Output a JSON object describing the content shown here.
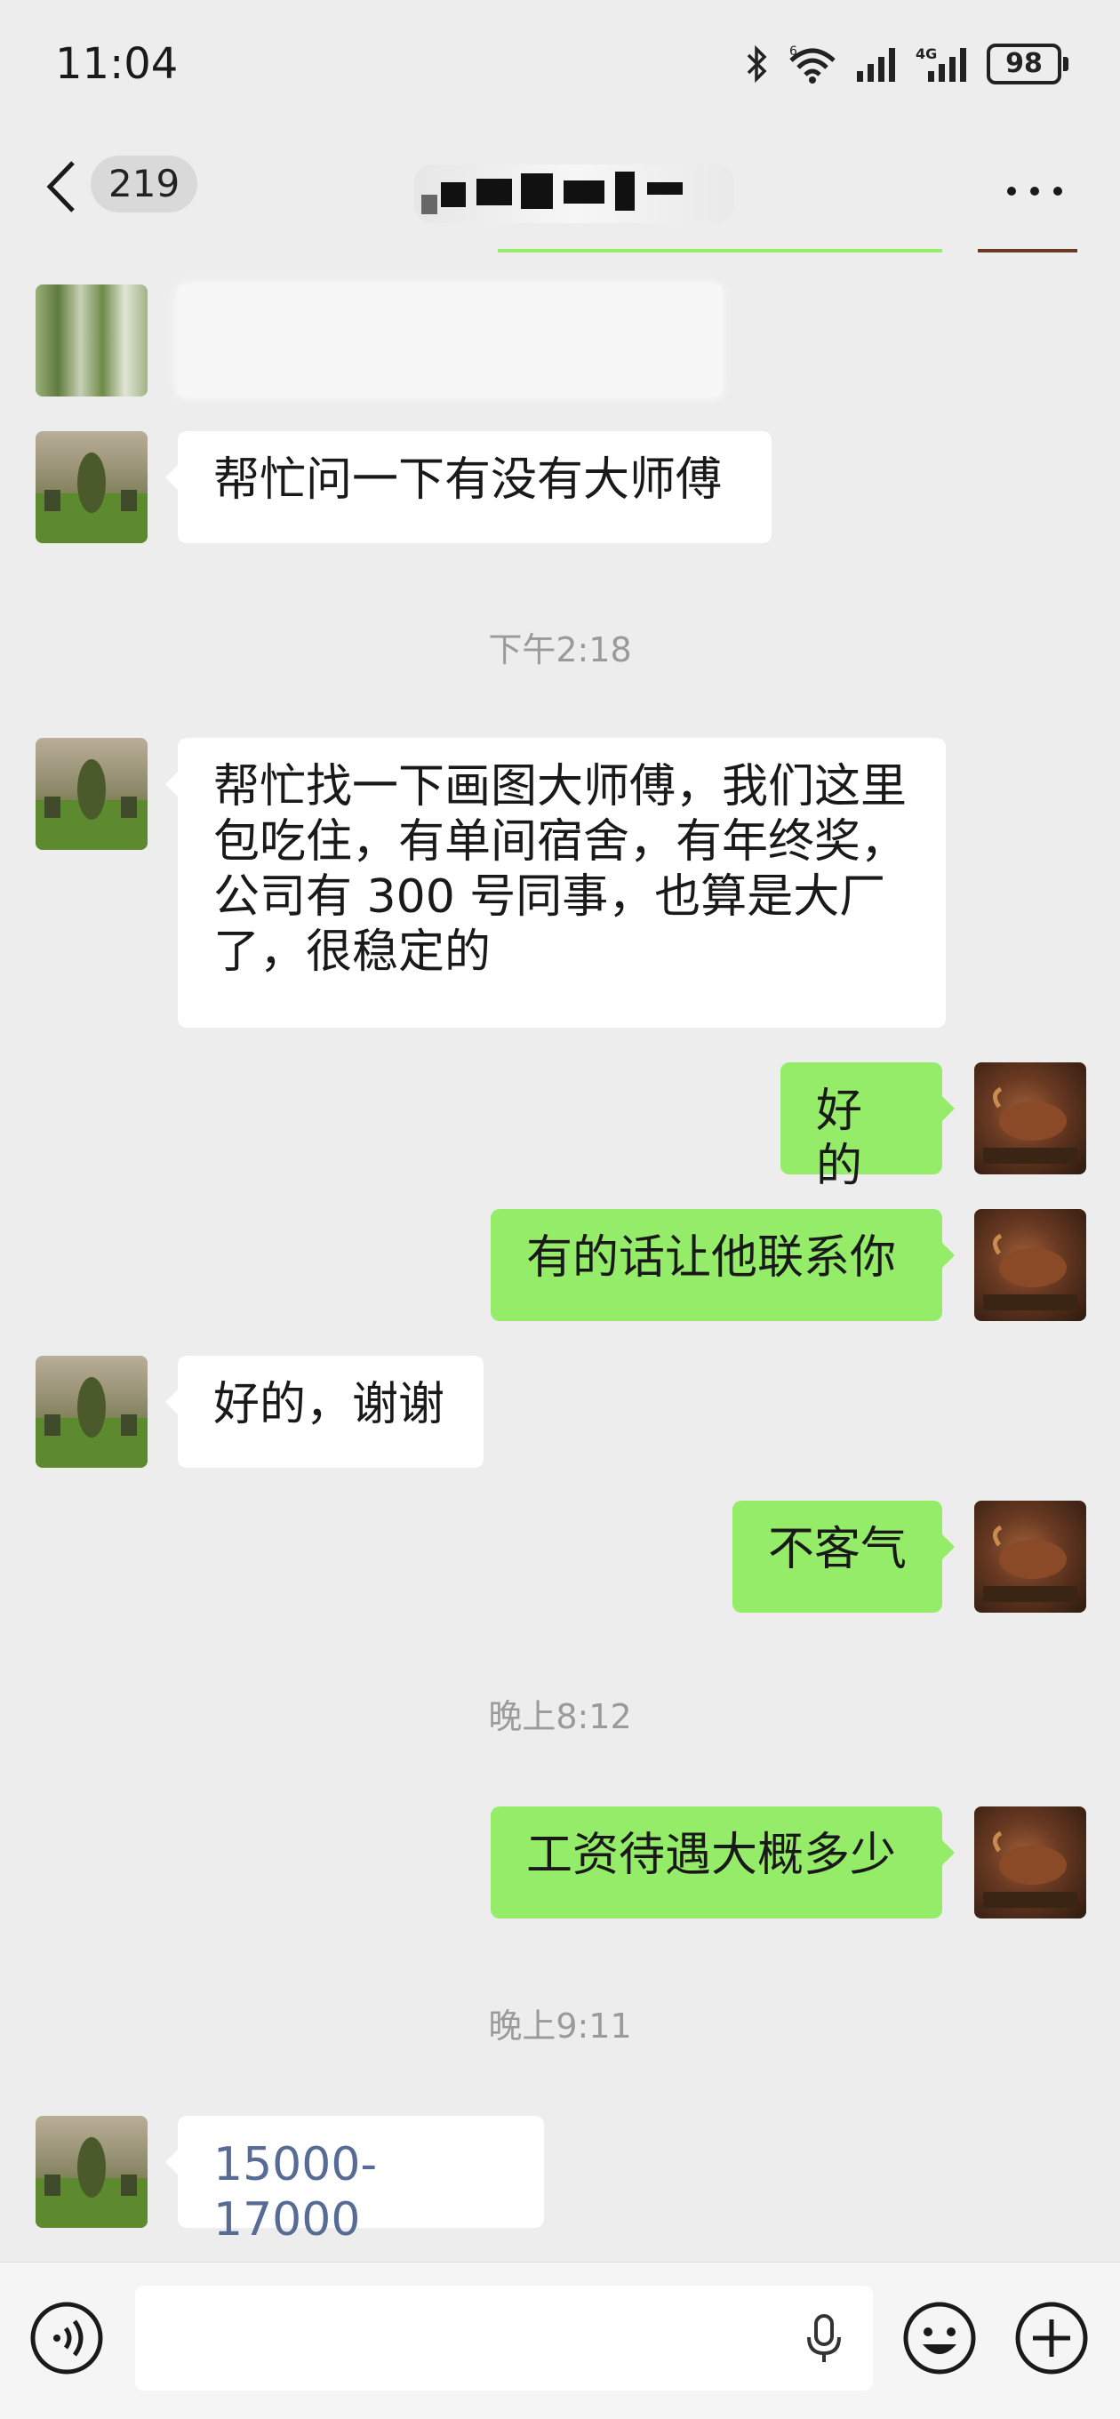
{
  "status_bar": {
    "time": "11:04",
    "battery": "98",
    "network": "4G",
    "wifi_badge": "6"
  },
  "nav": {
    "unread_count": "219",
    "title": "",
    "more_icon": "more-horizontal-icon"
  },
  "messages": [
    {
      "side": "left",
      "type": "blurred-text",
      "text": ""
    },
    {
      "side": "left",
      "text": "帮忙问一下有没有大师傅"
    },
    {
      "type": "timestamp",
      "text": "下午2:18"
    },
    {
      "side": "left",
      "text": "帮忙找一下画图大师傅，我们这里\n包吃住，有单间宿舍，有年终奖，\n公司有 300 号同事，也算是大厂\n了，很稳定的"
    },
    {
      "side": "right",
      "text": "好的"
    },
    {
      "side": "right",
      "text": "有的话让他联系你"
    },
    {
      "side": "left",
      "text": "好的，谢谢"
    },
    {
      "side": "right",
      "text": "不客气"
    },
    {
      "type": "timestamp",
      "text": "晚上8:12"
    },
    {
      "side": "right",
      "text": "工资待遇大概多少"
    },
    {
      "type": "timestamp",
      "text": "晚上9:11"
    },
    {
      "side": "left",
      "text": "15000-17000"
    }
  ],
  "input_bar": {
    "voice_icon": "voice-toggle-icon",
    "mic_icon": "microphone-icon",
    "emoji_icon": "emoji-icon",
    "plus_icon": "plus-circle-icon"
  },
  "colors": {
    "background": "#ededed",
    "self_bubble": "#95ec69",
    "other_bubble": "#ffffff",
    "link_number": "#576b95"
  }
}
